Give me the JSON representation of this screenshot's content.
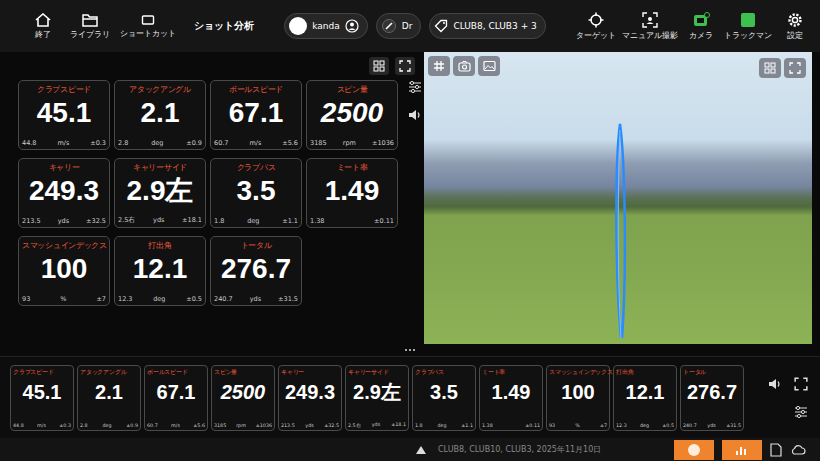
{
  "topbar": {
    "left_buttons": [
      {
        "label": "終了"
      },
      {
        "label": "ライブラリ"
      },
      {
        "label": "ショートカット"
      }
    ],
    "title": "ショット分析",
    "user": "kanda",
    "club": "Dr",
    "clubs_filter": "CLUB8, CLUB3 + 3",
    "right_buttons": [
      {
        "label": "ターゲット",
        "color": "#ffffff"
      },
      {
        "label": "マニュアル撮影",
        "color": "#ffffff"
      },
      {
        "label": "カメラ",
        "color": "#3fbf4f"
      },
      {
        "label": "トラックマン",
        "color": "#3fbf4f"
      },
      {
        "label": "設定",
        "color": "#ffffff"
      }
    ]
  },
  "metrics": [
    {
      "label": "クラブスピード",
      "value": "45.1",
      "average": "44.8",
      "unit": "m/s",
      "spread": "±0.3",
      "kind": "plain"
    },
    {
      "label": "アタックアングル",
      "value": "2.1",
      "average": "2.8",
      "unit": "deg",
      "spread": "±0.9",
      "kind": "plain"
    },
    {
      "label": "ボールスピード",
      "value": "67.1",
      "average": "60.7",
      "unit": "m/s",
      "spread": "±5.6",
      "kind": "plain"
    },
    {
      "label": "スピン量",
      "value": "2500",
      "average": "3185",
      "unit": "rpm",
      "spread": "±1036",
      "kind": "italic"
    },
    {
      "label": "キャリー",
      "value": "249.3",
      "average": "213.5",
      "unit": "yds",
      "spread": "±32.5",
      "kind": "plain"
    },
    {
      "label": "キャリーサイド",
      "value": "2.9左",
      "average": "2.5右",
      "unit": "yds",
      "spread": "±18.1",
      "kind": "plain"
    },
    {
      "label": "クラブパス",
      "value": "3.5",
      "average": "1.8",
      "unit": "deg",
      "spread": "±1.1",
      "kind": "plain"
    },
    {
      "label": "ミート率",
      "value": "1.49",
      "average": "1.38",
      "spread": "±0.11",
      "kind": "plain"
    },
    {
      "label": "スマッシュインデックス",
      "value": "100",
      "average": "93",
      "unit": "%",
      "spread": "±7",
      "kind": "plain"
    },
    {
      "label": "打出角",
      "value": "12.1",
      "average": "12.3",
      "unit": "deg",
      "spread": "±0.5",
      "kind": "plain"
    },
    {
      "label": "トータル",
      "value": "276.7",
      "average": "240.7",
      "unit": "yds",
      "spread": "±31.5",
      "kind": "plain"
    }
  ],
  "strip": [
    {
      "label": "クラブスピード",
      "value": "45.1",
      "average": "44.8",
      "unit": "m/s",
      "spread": "±0.3",
      "kind": "plain"
    },
    {
      "label": "アタックアングル",
      "value": "2.1",
      "average": "2.8",
      "unit": "deg",
      "spread": "±0.9",
      "kind": "plain"
    },
    {
      "label": "ボールスピード",
      "value": "67.1",
      "average": "60.7",
      "unit": "m/s",
      "spread": "±5.6",
      "kind": "plain"
    },
    {
      "label": "スピン量",
      "value": "2500",
      "average": "3185",
      "unit": "rpm",
      "spread": "±1036",
      "kind": "italic"
    },
    {
      "label": "キャリー",
      "value": "249.3",
      "average": "213.5",
      "unit": "yds",
      "spread": "±32.5",
      "kind": "plain"
    },
    {
      "label": "キャリーサイド",
      "value": "2.9左",
      "average": "2.5右",
      "unit": "yds",
      "spread": "±18.1",
      "kind": "plain"
    },
    {
      "label": "クラブパス",
      "value": "3.5",
      "average": "1.8",
      "unit": "deg",
      "spread": "±1.1",
      "kind": "plain"
    },
    {
      "label": "ミート率",
      "value": "1.49",
      "average": "1.38",
      "spread": "±0.11",
      "kind": "plain"
    },
    {
      "label": "スマッシュインデックス",
      "value": "100",
      "average": "93",
      "unit": "%",
      "spread": "±7",
      "kind": "plain"
    },
    {
      "label": "打出角",
      "value": "12.1",
      "average": "12.3",
      "unit": "deg",
      "spread": "±0.5",
      "kind": "plain"
    },
    {
      "label": "トータル",
      "value": "276.7",
      "average": "240.7",
      "unit": "yds",
      "spread": "±31.5",
      "kind": "plain"
    }
  ],
  "status_bar": {
    "text": "CLUB8, CLUB10, CLUB3, 2025年11月10日"
  }
}
